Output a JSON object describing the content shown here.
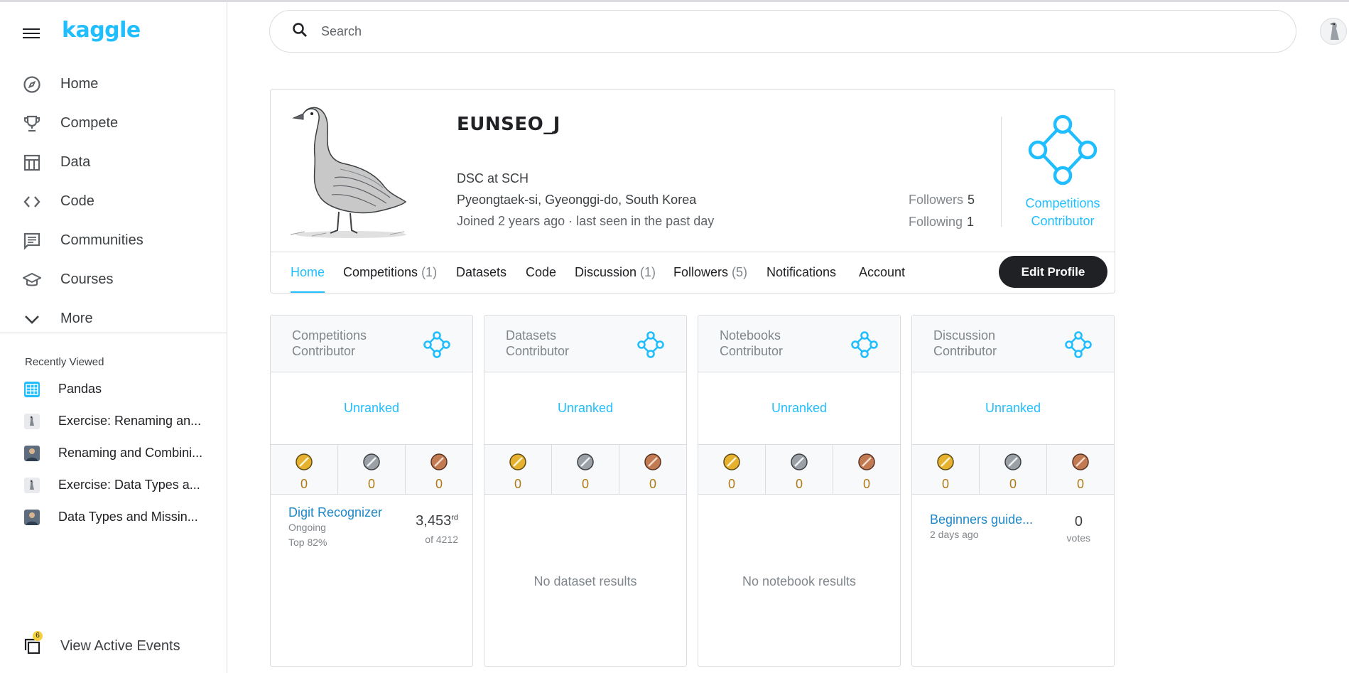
{
  "app": {
    "logo": "kaggle"
  },
  "sidebar": {
    "nav": [
      {
        "label": "Home",
        "icon": "compass-icon"
      },
      {
        "label": "Compete",
        "icon": "trophy-icon"
      },
      {
        "label": "Data",
        "icon": "table-icon"
      },
      {
        "label": "Code",
        "icon": "code-icon"
      },
      {
        "label": "Communities",
        "icon": "comment-icon"
      },
      {
        "label": "Courses",
        "icon": "school-icon"
      },
      {
        "label": "More",
        "icon": "chevron-down-icon"
      }
    ],
    "recently_viewed_title": "Recently Viewed",
    "recently_viewed": [
      {
        "label": "Pandas",
        "thumb": "course-thumb"
      },
      {
        "label": "Exercise: Renaming an...",
        "thumb": "goose-thumb"
      },
      {
        "label": "Renaming and Combini...",
        "thumb": "person-thumb"
      },
      {
        "label": "Exercise: Data Types a...",
        "thumb": "goose-thumb"
      },
      {
        "label": "Data Types and Missin...",
        "thumb": "person-thumb"
      }
    ],
    "events_label": "View Active Events",
    "events_badge": "6"
  },
  "search": {
    "placeholder": "Search"
  },
  "profile": {
    "username": "EUNSEO_J",
    "occupation": "DSC at SCH",
    "location": "Pyeongtaek-si, Gyeonggi-do, South Korea",
    "joined": "Joined 2 years ago · last seen in the past day",
    "followers_label": "Followers",
    "followers_count": "5",
    "following_label": "Following",
    "following_count": "1",
    "tier_line1": "Competitions",
    "tier_line2": "Contributor",
    "tabs": [
      {
        "label": "Home",
        "count": ""
      },
      {
        "label": "Competitions",
        "count": "(1)"
      },
      {
        "label": "Datasets",
        "count": ""
      },
      {
        "label": "Code",
        "count": ""
      },
      {
        "label": "Discussion",
        "count": "(1)"
      },
      {
        "label": "Followers",
        "count": "(5)"
      },
      {
        "label": "Notifications",
        "count": ""
      },
      {
        "label": "Account",
        "count": ""
      }
    ],
    "edit_button": "Edit Profile"
  },
  "cards": [
    {
      "title": "Competitions Contributor",
      "rank": "Unranked",
      "gold": "0",
      "silver": "0",
      "bronze": "0",
      "entry": {
        "title": "Digit Recognizer",
        "status": "Ongoing",
        "top": "Top 82%",
        "rank": "3,453",
        "rank_suffix": "rd",
        "of": "of 4212"
      }
    },
    {
      "title": "Datasets Contributor",
      "rank": "Unranked",
      "gold": "0",
      "silver": "0",
      "bronze": "0",
      "empty": "No dataset results"
    },
    {
      "title": "Notebooks Contributor",
      "rank": "Unranked",
      "gold": "0",
      "silver": "0",
      "bronze": "0",
      "empty": "No notebook results"
    },
    {
      "title": "Discussion Contributor",
      "rank": "Unranked",
      "gold": "0",
      "silver": "0",
      "bronze": "0",
      "post": {
        "title": "Beginners guide...",
        "time": "2 days ago",
        "votes": "0",
        "votes_label": "votes"
      }
    }
  ],
  "colors": {
    "accent": "#20beff",
    "gold": "#e6b12e",
    "silver": "#9aa0a6",
    "bronze": "#c27a52",
    "dark": "#202124"
  }
}
